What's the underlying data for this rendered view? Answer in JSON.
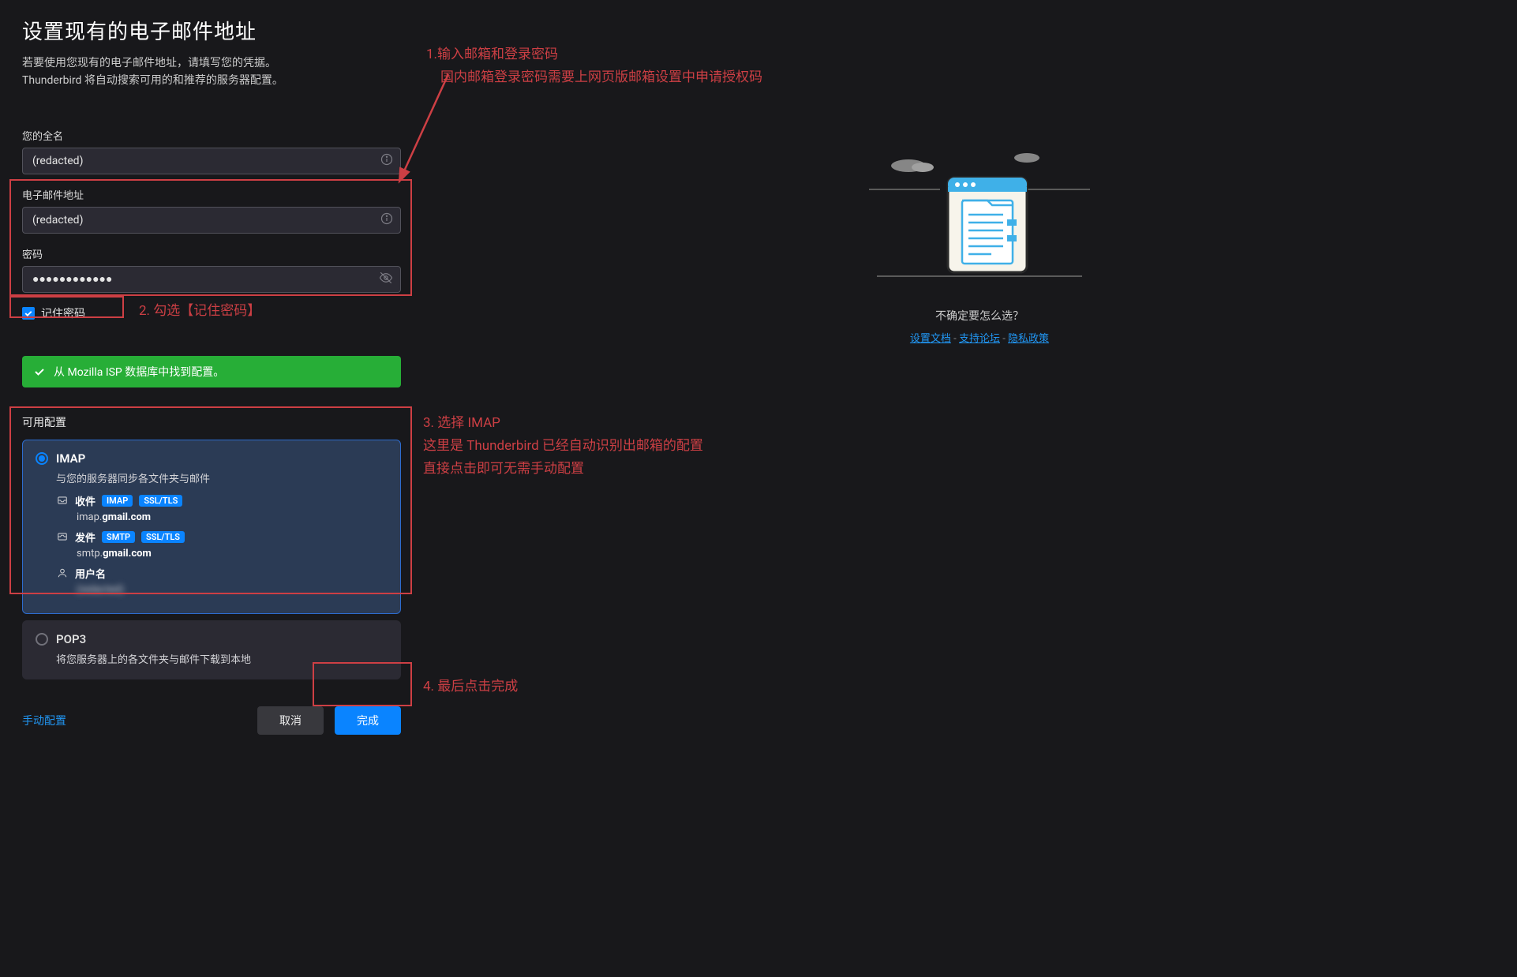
{
  "header": {
    "title": "设置现有的电子邮件地址",
    "subtitle1": "若要使用您现有的电子邮件地址，请填写您的凭据。",
    "subtitle2": "Thunderbird 将自动搜索可用的和推荐的服务器配置。"
  },
  "fields": {
    "fullname_label": "您的全名",
    "fullname_value": "(redacted)",
    "email_label": "电子邮件地址",
    "email_value": "(redacted)",
    "password_label": "密码",
    "password_value": "●●●●●●●●●●●●",
    "remember_label": "记住密码"
  },
  "success": "从 Mozilla ISP 数据库中找到配置。",
  "available": "可用配置",
  "imap": {
    "title": "IMAP",
    "desc": "与您的服务器同步各文件夹与邮件",
    "incoming_label": "收件",
    "incoming_proto": "IMAP",
    "incoming_sec": "SSL/TLS",
    "incoming_host_pre": "imap.",
    "incoming_host_bold": "gmail.com",
    "outgoing_label": "发件",
    "outgoing_proto": "SMTP",
    "outgoing_sec": "SSL/TLS",
    "outgoing_host_pre": "smtp.",
    "outgoing_host_bold": "gmail.com",
    "username_label": "用户名",
    "username_value": "(redacted)"
  },
  "pop3": {
    "title": "POP3",
    "desc": "将您服务器上的各文件夹与邮件下载到本地"
  },
  "buttons": {
    "manual": "手动配置",
    "cancel": "取消",
    "done": "完成"
  },
  "help": {
    "unsure": "不确定要怎么选？",
    "doc": "设置文档",
    "forum": "支持论坛",
    "privacy": "隐私政策"
  },
  "annotations": {
    "a1_l1": "1.输入邮箱和登录密码",
    "a1_l2": "国内邮箱登录密码需要上网页版邮箱设置中申请授权码",
    "a2": "2. 勾选【记住密码】",
    "a3_l1": "3. 选择 IMAP",
    "a3_l2": "这里是 Thunderbird 已经自动识别出邮箱的配置",
    "a3_l3": "直接点击即可无需手动配置",
    "a4": "4. 最后点击完成"
  }
}
